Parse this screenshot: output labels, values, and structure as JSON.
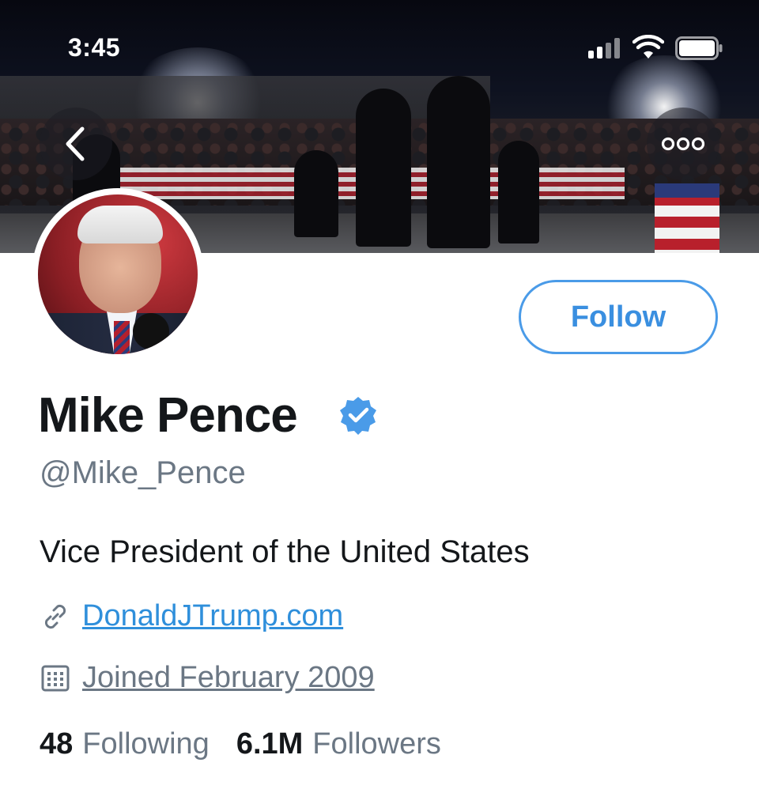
{
  "status_bar": {
    "time": "3:45"
  },
  "header": {
    "back_icon": "chevron-left-icon",
    "more_icon": "ellipsis-icon"
  },
  "profile": {
    "name": "Mike Pence",
    "verified": true,
    "handle": "@Mike_Pence",
    "bio": "Vice President of the United States",
    "website": "DonaldJTrump.com",
    "joined": "Joined February 2009",
    "follow_label": "Follow",
    "following_count": "48",
    "following_label": "Following",
    "followers_count": "6.1M",
    "followers_label": "Followers"
  },
  "colors": {
    "accent": "#3a8fe0",
    "verified": "#4a9be8",
    "muted_text": "#6b7784",
    "primary_text": "#14171a"
  }
}
